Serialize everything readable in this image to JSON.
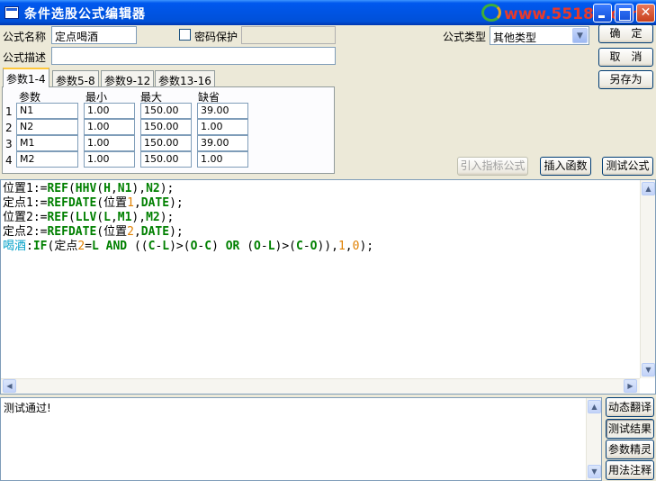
{
  "window": {
    "title": "条件选股公式编辑器"
  },
  "watermark": "www.55188.com",
  "form": {
    "name_label": "公式名称",
    "name_value": "定点喝酒",
    "password_label": "密码保护",
    "desc_label": "公式描述",
    "desc_value": "",
    "type_label": "公式类型",
    "type_value": "其他类型"
  },
  "buttons": {
    "ok": "确　定",
    "cancel": "取　消",
    "save_as": "另存为",
    "import_indicator": "引入指标公式",
    "insert_function": "插入函数",
    "test_formula": "测试公式"
  },
  "tabs": [
    "参数1-4",
    "参数5-8",
    "参数9-12",
    "参数13-16"
  ],
  "params": {
    "headers": [
      "参数",
      "最小",
      "最大",
      "缺省"
    ],
    "rows": [
      {
        "num": "1",
        "name": "N1",
        "min": "1.00",
        "max": "150.00",
        "default": "39.00"
      },
      {
        "num": "2",
        "name": "N2",
        "min": "1.00",
        "max": "150.00",
        "default": "1.00"
      },
      {
        "num": "3",
        "name": "M1",
        "min": "1.00",
        "max": "150.00",
        "default": "39.00"
      },
      {
        "num": "4",
        "name": "M2",
        "min": "1.00",
        "max": "150.00",
        "default": "1.00"
      }
    ]
  },
  "code": [
    "位置1:=REF(HHV(H,N1),N2);",
    "定点1:=REFDATE(位置1,DATE);",
    "位置2:=REF(LLV(L,M1),M2);",
    "定点2:=REFDATE(位置2,DATE);",
    "喝酒:IF(定点2=L AND ((C-L)>(O-C) OR (O-L)>(C-O)),1,0);"
  ],
  "output": {
    "text": "测试通过!"
  },
  "side_buttons": [
    "动态翻译",
    "测试结果",
    "参数精灵",
    "用法注释"
  ],
  "colors": {
    "titlebar": "#0054e3",
    "keyword": "#008000",
    "number": "#e08000",
    "output_var": "#00a0c8",
    "watermark": "#e83a2a"
  }
}
